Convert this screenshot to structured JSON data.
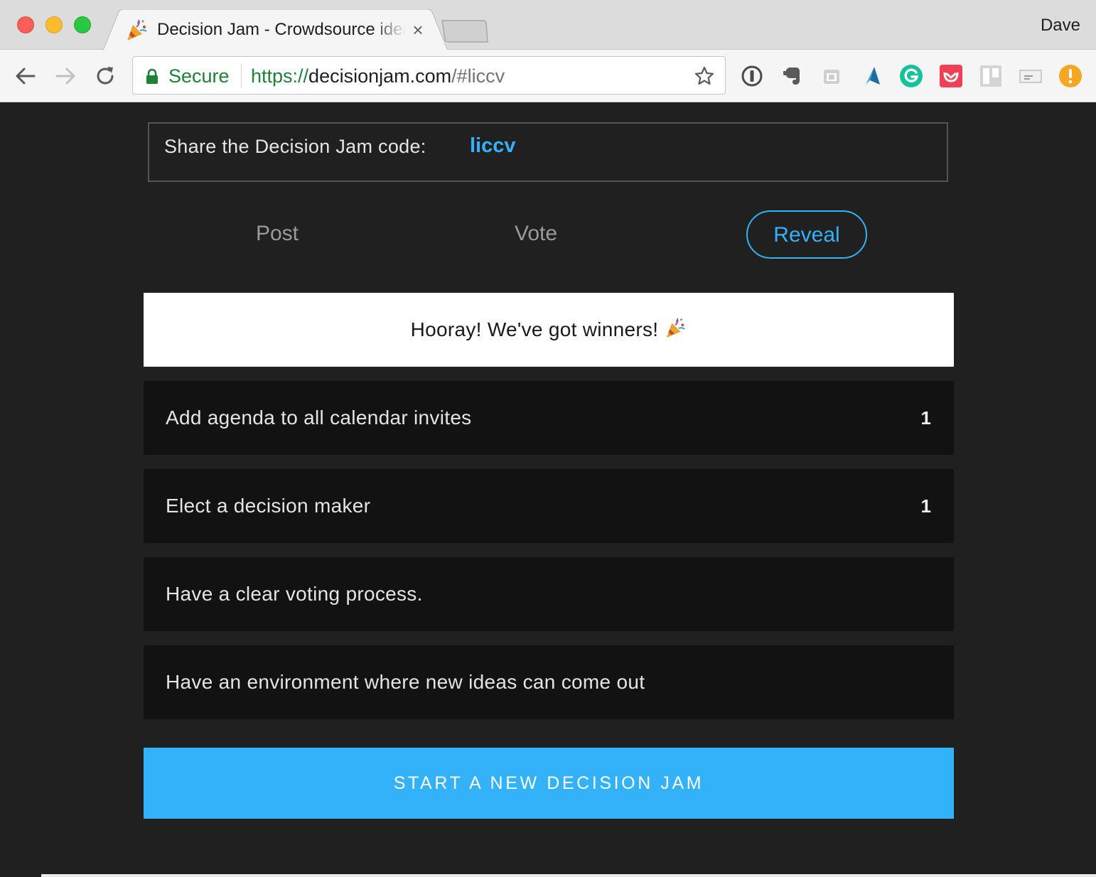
{
  "browser": {
    "tab_title": "Decision Jam - Crowdsource ideas",
    "tab_close": "×",
    "profile_name": "Dave",
    "secure_label": "Secure",
    "url": {
      "scheme": "https://",
      "host": "decisionjam.com",
      "path": "/#liccv"
    },
    "extensions": [
      "1password-icon",
      "evernote-icon",
      "calendar-extension-icon",
      "kite-icon",
      "grammarly-icon",
      "pocket-icon",
      "trello-icon",
      "mail-extension-icon",
      "alert-extension-icon"
    ]
  },
  "share": {
    "label": "Share the Decision Jam code:",
    "code": "liccv"
  },
  "steps": {
    "post": "Post",
    "vote": "Vote",
    "reveal": "Reveal",
    "active": "reveal"
  },
  "banner": {
    "text": "Hooray! We've got winners!"
  },
  "ideas": [
    {
      "text": "Add agenda to all calendar invites",
      "votes": "1"
    },
    {
      "text": "Elect a decision maker",
      "votes": "1"
    },
    {
      "text": "Have a clear voting process.",
      "votes": ""
    },
    {
      "text": "Have an environment where new ideas can come out",
      "votes": ""
    }
  ],
  "cta": {
    "label": "START A NEW DECISION JAM"
  },
  "colors": {
    "accent": "#33b2f9",
    "page_bg": "#202020",
    "card_bg": "#121212",
    "secure_green": "#1e8138"
  }
}
